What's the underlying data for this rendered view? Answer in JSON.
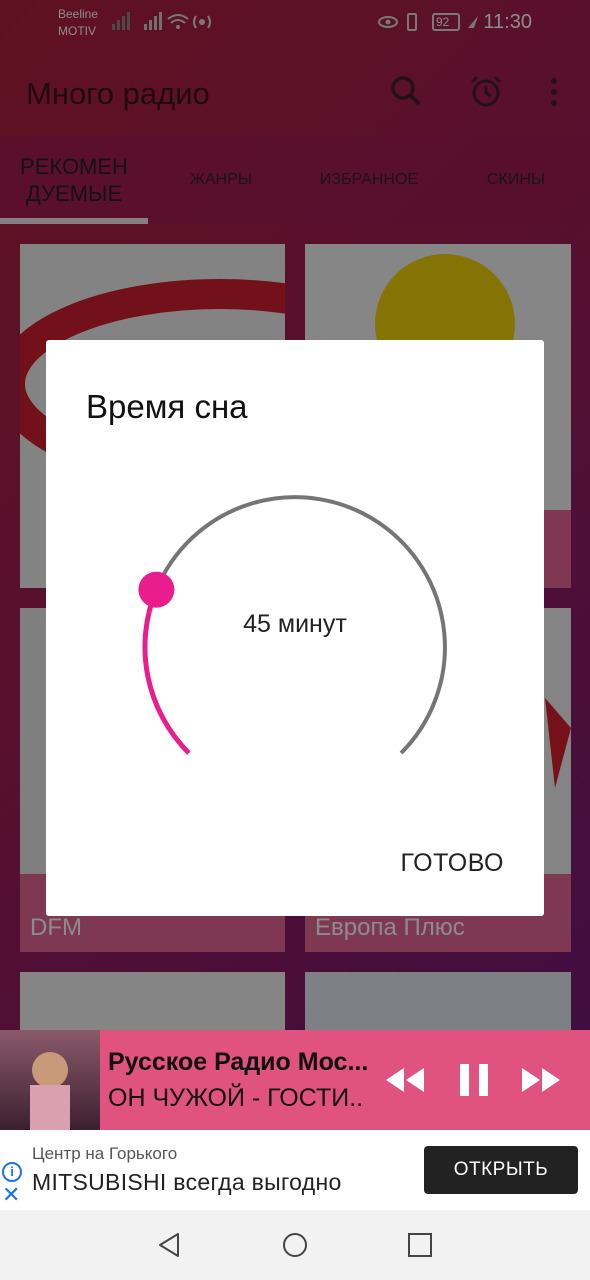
{
  "status_bar": {
    "carrier_line1": "Beeline",
    "carrier_line2": "MOTIV",
    "battery": "92",
    "time": "11:30"
  },
  "appbar": {
    "title": "Много радио",
    "icons": [
      "search-icon",
      "alarm-icon",
      "more-vert-icon"
    ]
  },
  "tabs": {
    "active_line1": "РЕКОМЕН",
    "active_line2": "ДУЕМЫЕ",
    "items": [
      "ЖАНРЫ",
      "ИЗБРАННОЕ",
      "СКИНЫ"
    ]
  },
  "cards": [
    {
      "label": "DFM"
    },
    {
      "label": "Европа Плюс"
    }
  ],
  "dialog": {
    "title": "Время сна",
    "value_text": "45 минут",
    "done_label": "ГОТОВО",
    "progress_fraction": 0.25,
    "colors": {
      "accent": "#e91e8c",
      "track": "#757575"
    }
  },
  "player": {
    "title": "Русское Радио Мос...",
    "subtitle": "ОН ЧУЖОЙ - ГОСТИ..",
    "controls": [
      "rewind-icon",
      "pause-icon",
      "fast-forward-icon"
    ]
  },
  "ad": {
    "small_text": "Центр на Горького",
    "main_text": "MITSUBISHI всегда выгодно",
    "button_label": "ОТКРЫТЬ"
  },
  "navbar": {
    "buttons": [
      "back-icon",
      "home-icon",
      "recents-icon"
    ]
  }
}
